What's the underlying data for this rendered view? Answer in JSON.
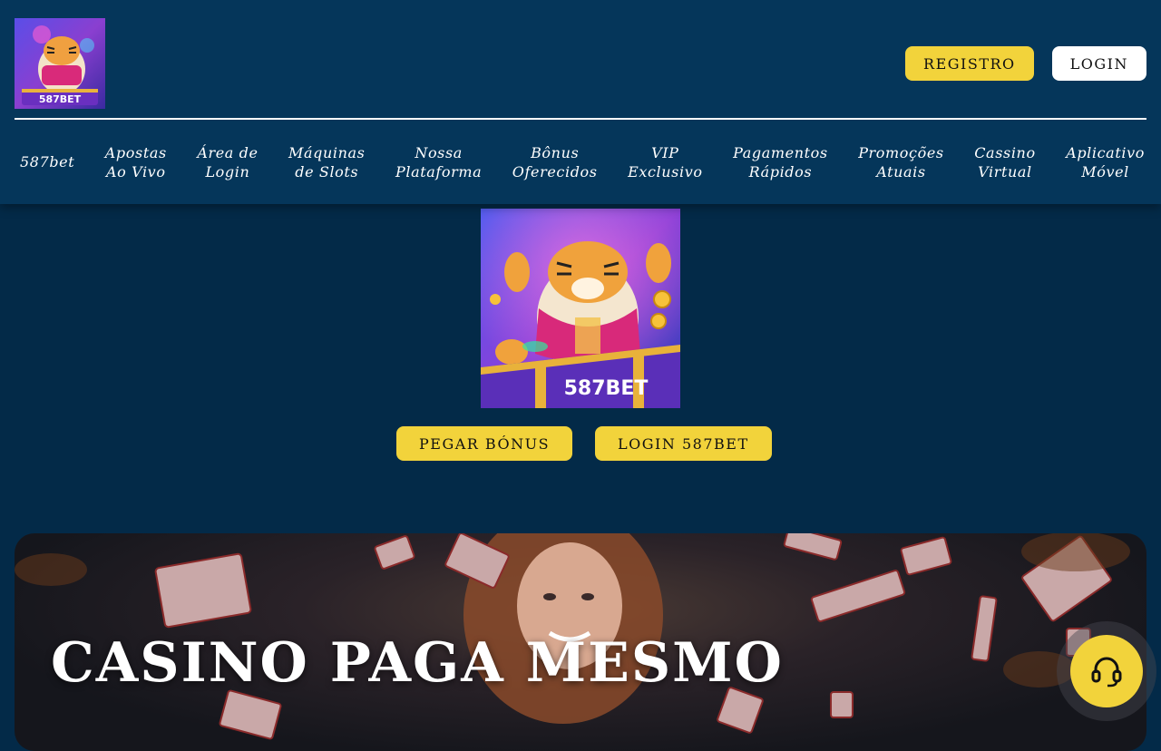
{
  "header": {
    "logo_text": "587BET",
    "register_label": "REGISTRO",
    "login_label": "LOGIN"
  },
  "nav": {
    "items": [
      {
        "line1": "587bet",
        "line2": ""
      },
      {
        "line1": "Apostas",
        "line2": "Ao Vivo"
      },
      {
        "line1": "Área de",
        "line2": "Login"
      },
      {
        "line1": "Máquinas",
        "line2": "de Slots"
      },
      {
        "line1": "Nossa",
        "line2": "Plataforma"
      },
      {
        "line1": "Bônus",
        "line2": "Oferecidos"
      },
      {
        "line1": "VIP",
        "line2": "Exclusivo"
      },
      {
        "line1": "Pagamentos",
        "line2": "Rápidos"
      },
      {
        "line1": "Promoções",
        "line2": "Atuais"
      },
      {
        "line1": "Cassino",
        "line2": "Virtual"
      },
      {
        "line1": "Aplicativo",
        "line2": "Móvel"
      }
    ]
  },
  "hero": {
    "image_text": "587BET",
    "bonus_label": "PEGAR BÓNUS",
    "login_label": "LOGIN 587BET"
  },
  "banner": {
    "title": "CASINO PAGA MESMO"
  },
  "support": {
    "icon": "headset-icon"
  },
  "colors": {
    "page_bg": "#032a48",
    "header_bg": "#05365a",
    "accent_yellow": "#f2d33b",
    "white": "#ffffff"
  }
}
